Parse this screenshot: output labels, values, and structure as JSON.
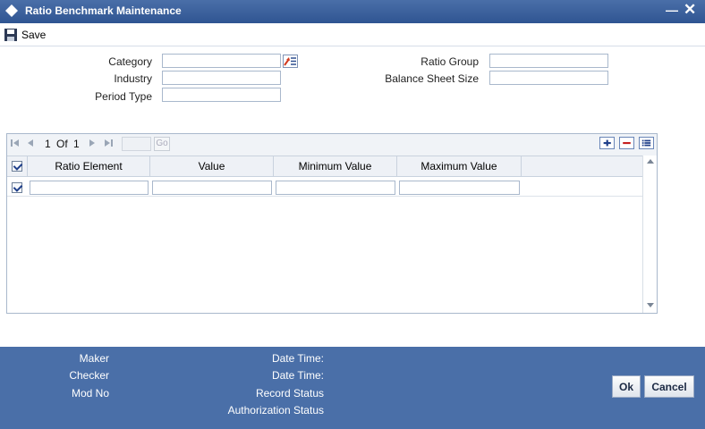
{
  "window": {
    "title": "Ratio Benchmark Maintenance"
  },
  "toolbar": {
    "save_label": "Save"
  },
  "form": {
    "category_label": "Category",
    "category_value": "",
    "industry_label": "Industry",
    "industry_value": "",
    "period_type_label": "Period Type",
    "period_type_value": "",
    "ratio_group_label": "Ratio Group",
    "ratio_group_value": "",
    "balance_sheet_size_label": "Balance Sheet Size",
    "balance_sheet_size_value": ""
  },
  "grid": {
    "page_current": "1",
    "page_of": "Of",
    "page_total": "1",
    "go_label": "Go",
    "columns": [
      "Ratio Element",
      "Value",
      "Minimum Value",
      "Maximum Value"
    ],
    "rows": [
      {
        "checked": true,
        "cells": [
          "",
          "",
          "",
          ""
        ]
      }
    ],
    "header_checked": true
  },
  "footer": {
    "maker_label": "Maker",
    "checker_label": "Checker",
    "mod_no_label": "Mod No",
    "date_time_label_1": "Date Time:",
    "date_time_label_2": "Date Time:",
    "record_status_label": "Record Status",
    "authorization_status_label": "Authorization Status",
    "ok_label": "Ok",
    "cancel_label": "Cancel"
  },
  "colors": {
    "titlebar": "#2f5592",
    "footer": "#4a6fa8"
  }
}
